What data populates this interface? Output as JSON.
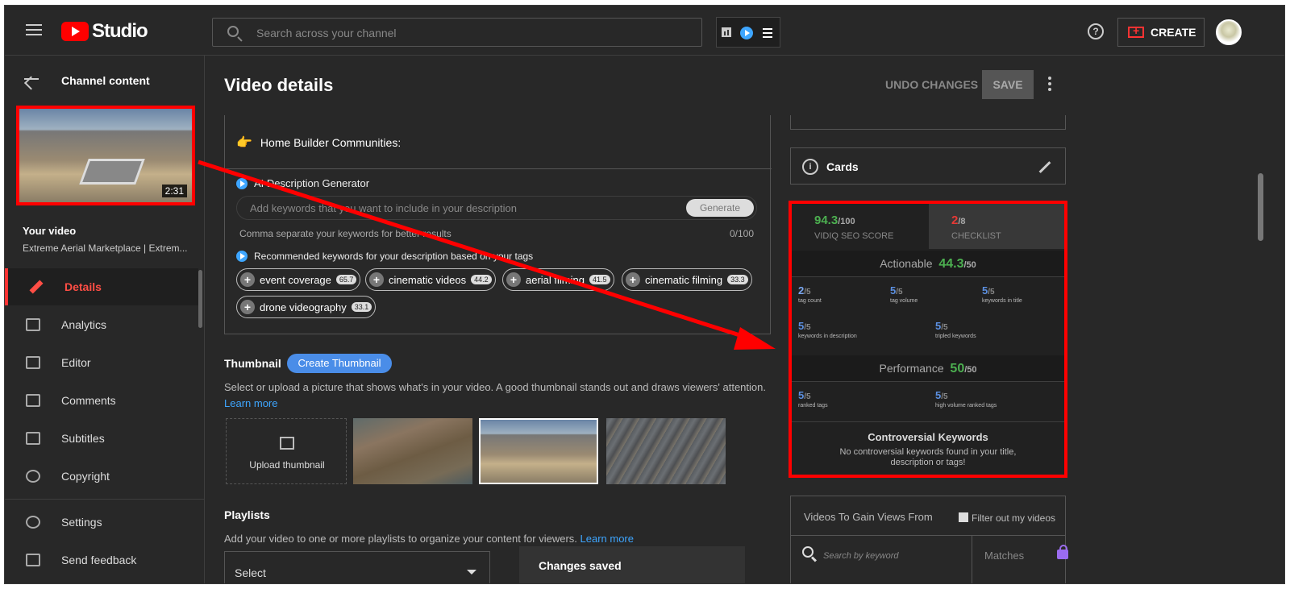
{
  "topbar": {
    "app_name": "Studio",
    "search_placeholder": "Search across your channel",
    "create_label": "CREATE"
  },
  "sidebar": {
    "section_title": "Channel content",
    "video_duration": "2:31",
    "your_video_label": "Your video",
    "video_title": "Extreme Aerial Marketplace | Extrem...",
    "nav": [
      {
        "label": "Details",
        "active": true
      },
      {
        "label": "Analytics"
      },
      {
        "label": "Editor"
      },
      {
        "label": "Comments"
      },
      {
        "label": "Subtitles"
      },
      {
        "label": "Copyright"
      },
      {
        "label": "Settings"
      },
      {
        "label": "Send feedback"
      }
    ]
  },
  "main": {
    "title": "Video details",
    "undo_label": "UNDO CHANGES",
    "save_label": "SAVE",
    "description": {
      "home_builder": "Home Builder Communities:",
      "ai_title": "AI Description Generator",
      "keywords_placeholder": "Add keywords that you want to include in your description",
      "generate_label": "Generate",
      "comma_note": "Comma separate your keywords for better results",
      "count": "0/100",
      "recommended_title": "Recommended keywords for your description based on your tags",
      "chips": [
        {
          "label": "event coverage",
          "score": "65.7"
        },
        {
          "label": "cinematic videos",
          "score": "44.2"
        },
        {
          "label": "aerial filming",
          "score": "41.5"
        },
        {
          "label": "cinematic filming",
          "score": "33.3"
        },
        {
          "label": "drone videography",
          "score": "33.1"
        }
      ]
    },
    "thumbnail": {
      "title": "Thumbnail",
      "create_label": "Create Thumbnail",
      "description": "Select or upload a picture that shows what's in your video. A good thumbnail stands out and draws viewers' attention.",
      "learn_more": "Learn more",
      "upload_label": "Upload thumbnail"
    },
    "playlists": {
      "title": "Playlists",
      "description": "Add your video to one or more playlists to organize your content for viewers.",
      "learn_more": "Learn more",
      "select_label": "Select"
    },
    "toast": "Changes saved"
  },
  "right_panel": {
    "cards_label": "Cards",
    "seo": {
      "score": "94.3",
      "score_max": "/100",
      "score_caption": "VIDIQ SEO SCORE",
      "checklist": "2",
      "checklist_max": "/8",
      "checklist_caption": "CHECKLIST",
      "actionable_label": "Actionable",
      "actionable_value": "44.3",
      "actionable_max": "/50",
      "metrics_row1": [
        {
          "value": "2",
          "max": "/5",
          "caption": "tag count"
        },
        {
          "value": "5",
          "max": "/5",
          "caption": "tag volume"
        },
        {
          "value": "5",
          "max": "/5",
          "caption": "keywords in title"
        }
      ],
      "metrics_row2": [
        {
          "value": "5",
          "max": "/5",
          "caption": "keywords in description"
        },
        {
          "value": "5",
          "max": "/5",
          "caption": "tripled keywords"
        }
      ],
      "performance_label": "Performance",
      "performance_value": "50",
      "performance_max": "/50",
      "metrics_row3": [
        {
          "value": "5",
          "max": "/5",
          "caption": "ranked tags"
        },
        {
          "value": "5",
          "max": "/5",
          "caption": "high volume ranked tags"
        }
      ],
      "controversial_title": "Controversial Keywords",
      "controversial_desc": "No controversial keywords found in your title, description or tags!"
    },
    "gain": {
      "title": "Videos To Gain Views From",
      "filter_label": "Filter out my videos",
      "search_placeholder": "Search by keyword",
      "matches_label": "Matches"
    }
  },
  "colors": {
    "accent_red": "#ff0000",
    "score_green": "#4caf50",
    "link_blue": "#3ea6ff"
  }
}
